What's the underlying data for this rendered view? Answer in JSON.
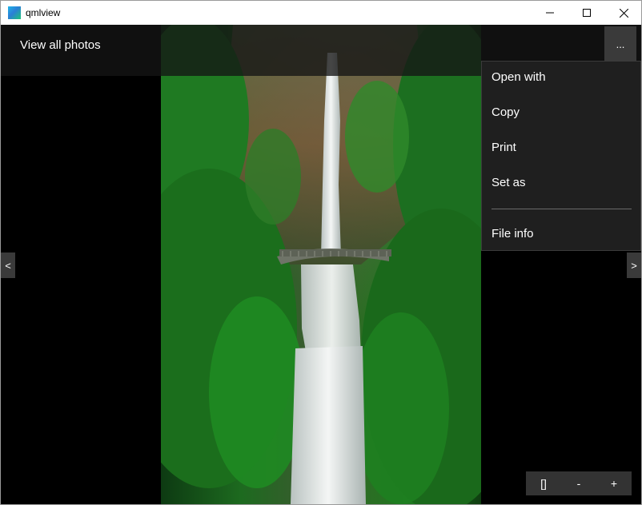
{
  "window": {
    "title": "qmlview",
    "icon": "qml-app-icon"
  },
  "header": {
    "view_all_label": "View all photos",
    "more_label": "..."
  },
  "menu": {
    "items": [
      {
        "label": "Open with"
      },
      {
        "label": "Copy"
      },
      {
        "label": "Print"
      },
      {
        "label": "Set as"
      },
      {
        "label": "File info"
      }
    ]
  },
  "navigation": {
    "prev_label": "<",
    "next_label": ">"
  },
  "zoom": {
    "fit_label": "[]",
    "out_label": "-",
    "in_label": "+"
  },
  "colors": {
    "background": "#000000",
    "menu_background": "#1f1f1f",
    "button_background": "#333333"
  }
}
